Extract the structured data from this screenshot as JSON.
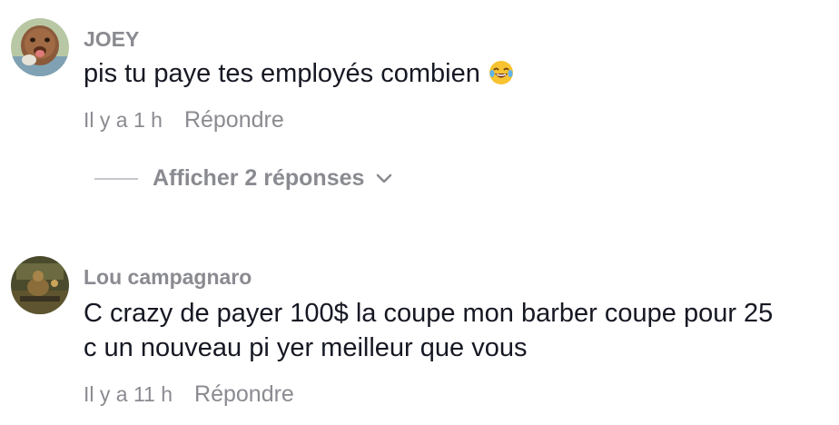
{
  "comments": [
    {
      "username": "JOEY",
      "text_lines": [
        "pis tu paye tes employés combien"
      ],
      "emoji": "joy-emoji",
      "time": "Il y a 1 h",
      "reply_label": "Répondre",
      "replies_label": "Afficher 2 réponses"
    },
    {
      "username": "Lou campagnaro",
      "text_lines": [
        "C crazy de payer 100$ la coupe mon barber coupe pour 25",
        "c un nouveau pi yer meilleur que vous"
      ],
      "time": "Il y a 11 h",
      "reply_label": "Répondre"
    }
  ],
  "colors": {
    "text": "#161823",
    "muted": "#8a8b91",
    "divider": "#c6c7cb"
  }
}
